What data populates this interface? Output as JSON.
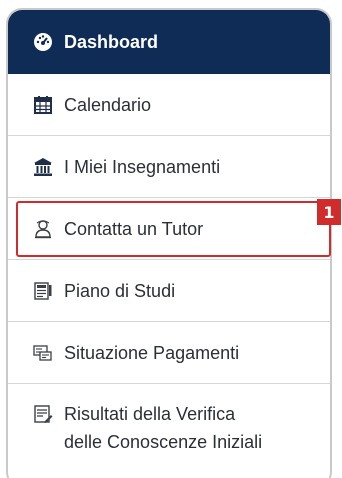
{
  "menu": {
    "items": [
      {
        "label": "Dashboard",
        "icon": "dashboard-icon"
      },
      {
        "label": "Calendario",
        "icon": "calendar-icon"
      },
      {
        "label": "I Miei Insegnamenti",
        "icon": "institution-icon"
      },
      {
        "label": "Contatta un Tutor",
        "icon": "tutor-icon"
      },
      {
        "label": "Piano di Studi",
        "icon": "study-plan-icon"
      },
      {
        "label": "Situazione Pagamenti",
        "icon": "payments-icon"
      },
      {
        "label": "Risultati della Verifica",
        "label2": "delle Conoscenze Iniziali",
        "icon": "verification-results-icon"
      }
    ]
  },
  "annotation": {
    "badge": "1"
  },
  "colors": {
    "header_bg": "#0f2c57",
    "highlight": "#d12c2c",
    "text": "#2b2f36"
  }
}
